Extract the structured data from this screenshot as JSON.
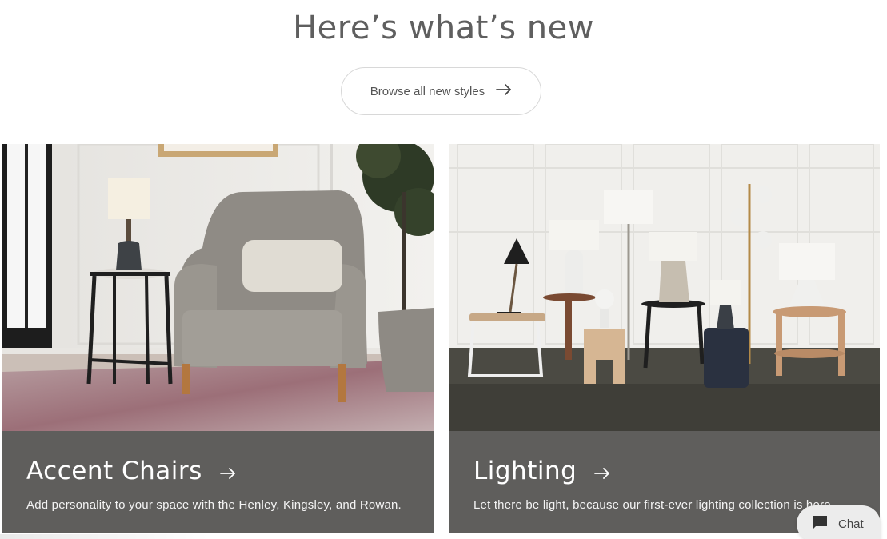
{
  "section": {
    "heading": "Here’s what’s new",
    "browse_button_label": "Browse all new styles",
    "browse_button_icon": "arrow-right-icon"
  },
  "cards": [
    {
      "title": "Accent Chairs",
      "description": "Add personality to your space with the Henley, Kingsley, and Rowan.",
      "icon": "arrow-right-icon",
      "image": "accent-chair-photo"
    },
    {
      "title": "Lighting",
      "description": "Let there be light, because our first-ever lighting collection is here.",
      "icon": "arrow-right-icon",
      "image": "lighting-collection-photo"
    }
  ],
  "chat": {
    "label": "Chat",
    "icon": "chat-bubble-icon"
  },
  "colors": {
    "caption_background": "#5f5e5c",
    "heading_text": "#5f5f5f",
    "button_border": "#d8d8d8"
  }
}
